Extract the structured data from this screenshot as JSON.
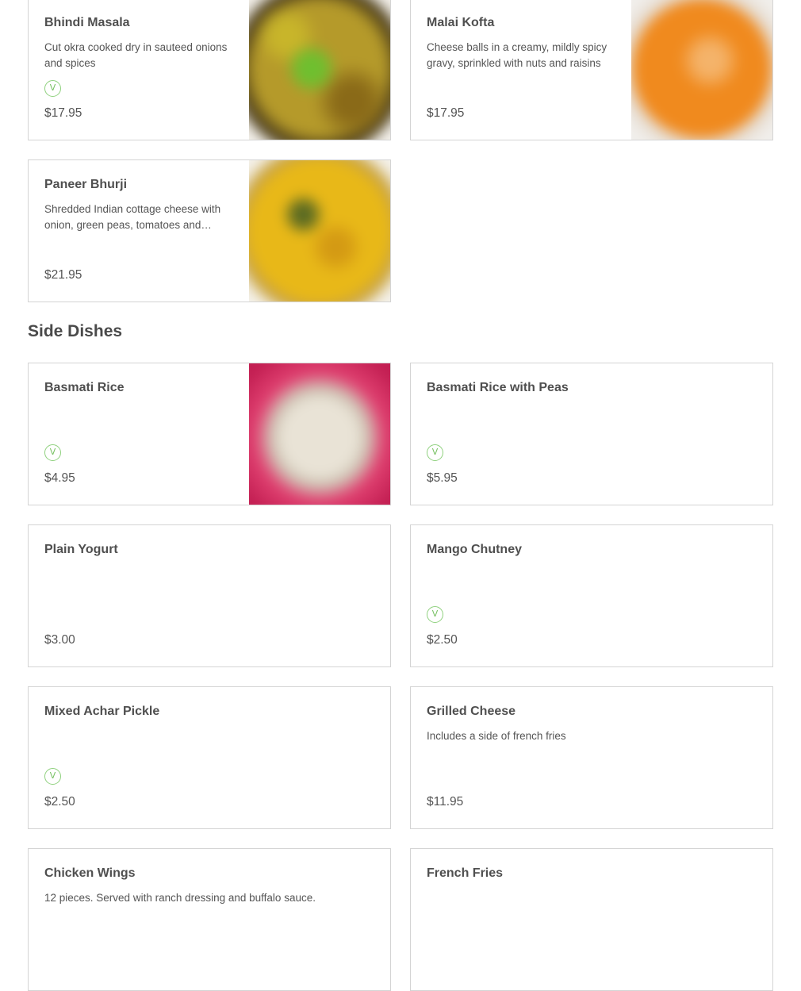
{
  "veg_symbol": "V",
  "top_items": [
    {
      "name": "Bhindi Masala",
      "desc": "Cut okra cooked dry in sauteed onions and spices",
      "price": "$17.95",
      "veg": true,
      "image": "okra-dish-photo"
    },
    {
      "name": "Malai Kofta",
      "desc": "Cheese balls in a creamy, mildly spicy gravy, sprinkled with nuts and raisins",
      "price": "$17.95",
      "veg": false,
      "image": "kofta-curry-photo"
    },
    {
      "name": "Paneer Bhurji",
      "desc": "Shredded Indian cottage cheese with onion, green peas, tomatoes and spices",
      "price": "$21.95",
      "veg": false,
      "image": "paneer-dish-photo"
    }
  ],
  "section": {
    "title": "Side Dishes"
  },
  "side_items": [
    {
      "name": "Basmati Rice",
      "desc": "",
      "price": "$4.95",
      "veg": true,
      "image": "rice-photo"
    },
    {
      "name": "Basmati Rice with Peas",
      "desc": "",
      "price": "$5.95",
      "veg": true
    },
    {
      "name": "Plain Yogurt",
      "desc": "",
      "price": "$3.00",
      "veg": false
    },
    {
      "name": "Mango Chutney",
      "desc": "",
      "price": "$2.50",
      "veg": true
    },
    {
      "name": "Mixed Achar Pickle",
      "desc": "",
      "price": "$2.50",
      "veg": true
    },
    {
      "name": "Grilled Cheese",
      "desc": "Includes a side of french fries",
      "price": "$11.95",
      "veg": false
    },
    {
      "name": "Chicken Wings",
      "desc": "12 pieces. Served with ranch dressing and buffalo sauce.",
      "price": "",
      "veg": false
    },
    {
      "name": "French Fries",
      "desc": "",
      "price": "",
      "veg": false
    }
  ]
}
